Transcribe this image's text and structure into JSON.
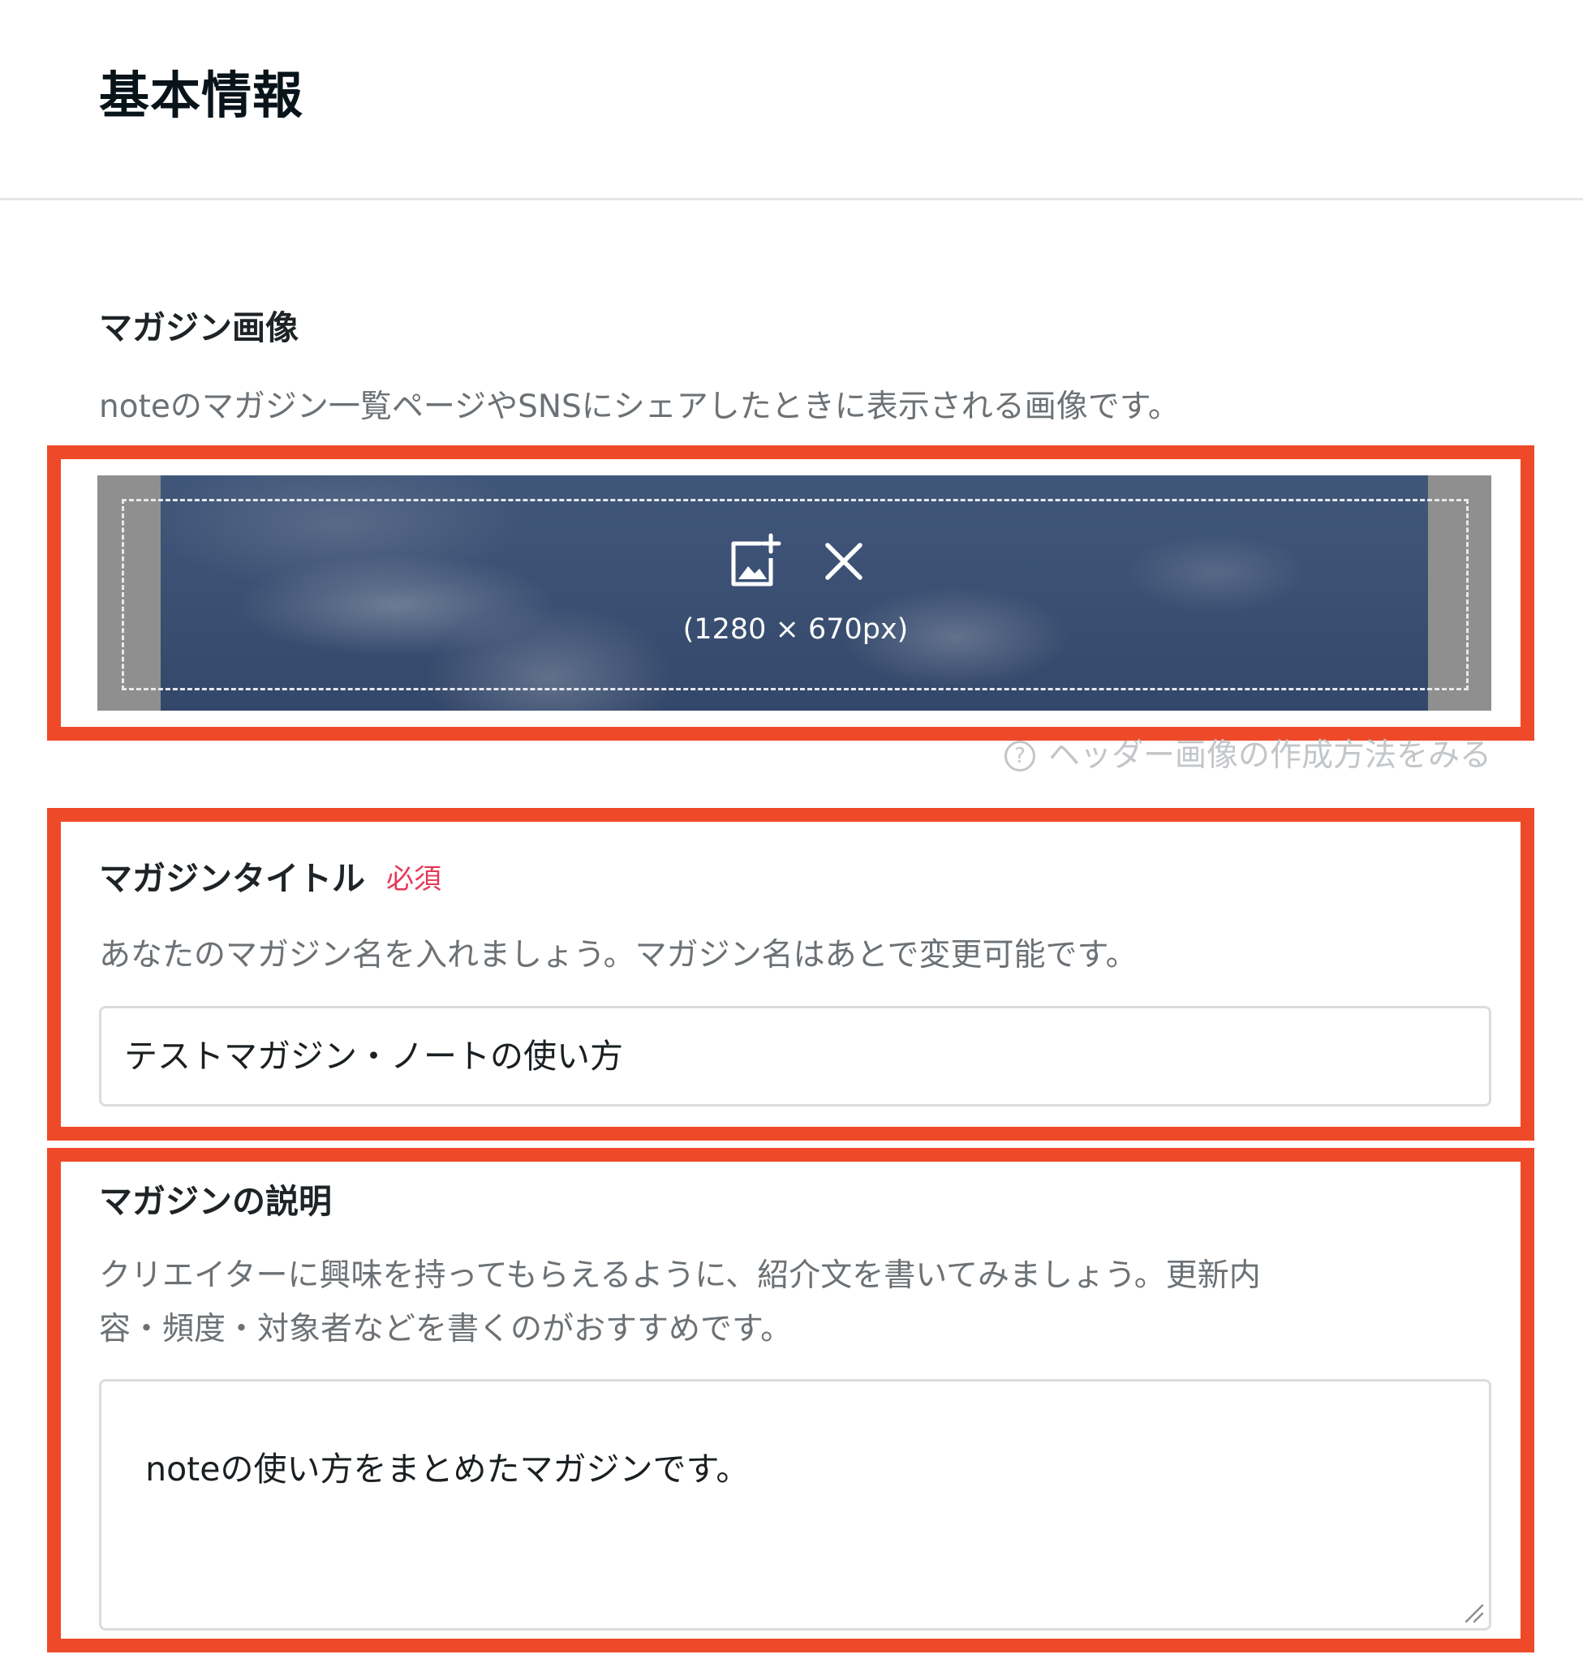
{
  "page": {
    "title": "基本情報"
  },
  "image_section": {
    "label": "マガジン画像",
    "description": "noteのマガジン一覧ページやSNSにシェアしたときに表示される画像です。",
    "size_hint": "(1280 × 670px)",
    "add_icon": "add-image-icon",
    "remove_icon": "close-icon",
    "help_icon": "question-circle-icon",
    "help_link": "ヘッダー画像の作成方法をみる"
  },
  "title_section": {
    "label": "マガジンタイトル",
    "required_badge": "必須",
    "description": "あなたのマガジン名を入れましょう。マガジン名はあとで変更可能です。",
    "value": "テストマガジン・ノートの使い方"
  },
  "description_section": {
    "label": "マガジンの説明",
    "description_line1": "クリエイターに興味を持ってもらえるように、紹介文を書いてみましょう。更新内",
    "description_line2": "容・頻度・対象者などを書くのがおすすめです。",
    "value": "noteの使い方をまとめたマガジンです。"
  },
  "colors": {
    "highlight": "#ee4a2a",
    "required": "#e5395a",
    "sky": "#3a4f72"
  }
}
